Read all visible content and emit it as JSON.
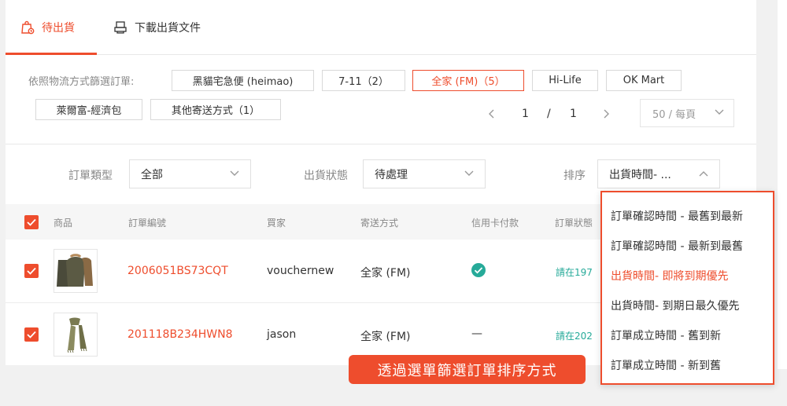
{
  "tabs": [
    {
      "label": "待出貨",
      "icon": "shipping-bag-icon",
      "active": true
    },
    {
      "label": "下載出貨文件",
      "icon": "printer-icon",
      "active": false
    }
  ],
  "filter": {
    "label": "依照物流方式篩選訂單:",
    "chips": [
      {
        "label": "黑貓宅急便 (heimao)",
        "active": false
      },
      {
        "label": "7-11（2）",
        "active": false
      },
      {
        "label": "全家 (FM)（5）",
        "active": true
      },
      {
        "label": "Hi-Life",
        "active": false
      },
      {
        "label": "OK Mart",
        "active": false
      },
      {
        "label": "萊爾富-經濟包",
        "active": false
      },
      {
        "label": "其他寄送方式（1）",
        "active": false
      }
    ]
  },
  "pagination": {
    "current": "1",
    "separator": "/",
    "total": "1",
    "per_page": "50 / 每頁"
  },
  "selects": {
    "order_type": {
      "label": "訂單類型",
      "value": "全部"
    },
    "ship_status": {
      "label": "出貨狀態",
      "value": "待處理"
    },
    "sort": {
      "label": "排序",
      "value": "出貨時間- ..."
    }
  },
  "table": {
    "headers": [
      "商品",
      "訂單編號",
      "買家",
      "寄送方式",
      "信用卡付款",
      "訂單狀態"
    ],
    "rows": [
      {
        "order_no": "2006051BS73CQT",
        "buyer": "vouchernew",
        "shipping": "全家 (FM)",
        "credit_card": "check",
        "status": "請在197"
      },
      {
        "order_no": "201118B234HWN8",
        "buyer": "jason",
        "shipping": "全家 (FM)",
        "credit_card": "—",
        "status": "請在202"
      }
    ]
  },
  "sort_menu": {
    "options": [
      {
        "label": "訂單確認時間 - 最舊到最新",
        "active": false
      },
      {
        "label": "訂單確認時間 - 最新到最舊",
        "active": false
      },
      {
        "label": "出貨時間- 即將到期優先",
        "active": true
      },
      {
        "label": "出貨時間- 到期日最久優先",
        "active": false
      },
      {
        "label": "訂單成立時間 - 舊到新",
        "active": false
      },
      {
        "label": "訂單成立時間 - 新到舊",
        "active": false
      }
    ]
  },
  "banner": {
    "text": "透過選單篩選訂單排序方式"
  },
  "colors": {
    "accent": "#ee4d2d",
    "success": "#26aa99",
    "checkbox": "#ee4d2d"
  }
}
